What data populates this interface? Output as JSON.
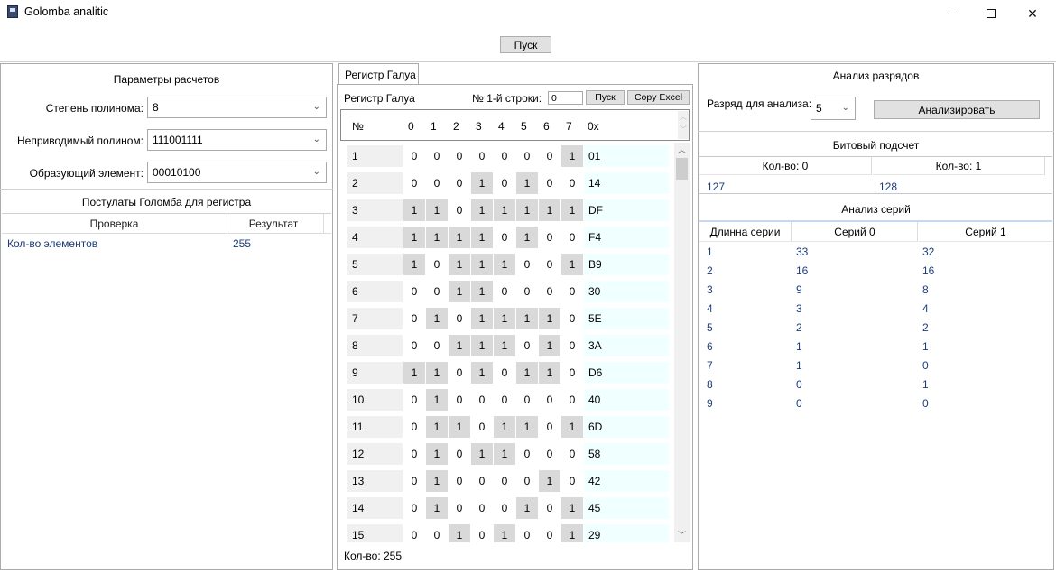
{
  "window": {
    "title": "Golomba analitic"
  },
  "toolbar": {
    "start_label": "Пуск"
  },
  "left": {
    "params_title": "Параметры расчетов",
    "degree_label": "Степень полинома:",
    "degree_value": "8",
    "irreducible_label": "Неприводимый полином:",
    "irreducible_value": "111001111",
    "generator_label": "Образующий элемент:",
    "generator_value": "00010100",
    "postulates_title": "Постулаты Голомба для регистра",
    "col_check": "Проверка",
    "col_result": "Результат",
    "rows": [
      {
        "check": "Кол-во элементов",
        "result": "255"
      }
    ]
  },
  "middle": {
    "tab_label": "Регистр Галуа",
    "register_label": "Регистр Галуа",
    "row_label": "№ 1-й строки:",
    "row_value": "0",
    "run_label": "Пуск",
    "copy_label": "Copy Excel",
    "headers": [
      "№",
      "0",
      "1",
      "2",
      "3",
      "4",
      "5",
      "6",
      "7",
      "0x"
    ],
    "rows": [
      {
        "n": "1",
        "bits": [
          0,
          0,
          0,
          0,
          0,
          0,
          0,
          1
        ],
        "hex": "01"
      },
      {
        "n": "2",
        "bits": [
          0,
          0,
          0,
          1,
          0,
          1,
          0,
          0
        ],
        "hex": "14"
      },
      {
        "n": "3",
        "bits": [
          1,
          1,
          0,
          1,
          1,
          1,
          1,
          1
        ],
        "hex": "DF"
      },
      {
        "n": "4",
        "bits": [
          1,
          1,
          1,
          1,
          0,
          1,
          0,
          0
        ],
        "hex": "F4"
      },
      {
        "n": "5",
        "bits": [
          1,
          0,
          1,
          1,
          1,
          0,
          0,
          1
        ],
        "hex": "B9"
      },
      {
        "n": "6",
        "bits": [
          0,
          0,
          1,
          1,
          0,
          0,
          0,
          0
        ],
        "hex": "30"
      },
      {
        "n": "7",
        "bits": [
          0,
          1,
          0,
          1,
          1,
          1,
          1,
          0
        ],
        "hex": "5E"
      },
      {
        "n": "8",
        "bits": [
          0,
          0,
          1,
          1,
          1,
          0,
          1,
          0
        ],
        "hex": "3A"
      },
      {
        "n": "9",
        "bits": [
          1,
          1,
          0,
          1,
          0,
          1,
          1,
          0
        ],
        "hex": "D6"
      },
      {
        "n": "10",
        "bits": [
          0,
          1,
          0,
          0,
          0,
          0,
          0,
          0
        ],
        "hex": "40"
      },
      {
        "n": "11",
        "bits": [
          0,
          1,
          1,
          0,
          1,
          1,
          0,
          1
        ],
        "hex": "6D"
      },
      {
        "n": "12",
        "bits": [
          0,
          1,
          0,
          1,
          1,
          0,
          0,
          0
        ],
        "hex": "58"
      },
      {
        "n": "13",
        "bits": [
          0,
          1,
          0,
          0,
          0,
          0,
          1,
          0
        ],
        "hex": "42"
      },
      {
        "n": "14",
        "bits": [
          0,
          1,
          0,
          0,
          0,
          1,
          0,
          1
        ],
        "hex": "45"
      },
      {
        "n": "15",
        "bits": [
          0,
          0,
          1,
          0,
          1,
          0,
          0,
          1
        ],
        "hex": "29"
      }
    ],
    "count_label": "Кол-во: 255"
  },
  "right": {
    "bits_title": "Анализ разрядов",
    "digit_label": "Разряд для анализа:",
    "digit_value": "5",
    "analyze_label": "Анализировать",
    "bitcount_title": "Битовый подсчет",
    "count0_header": "Кол-во: 0",
    "count1_header": "Кол-во: 1",
    "count0_value": "127",
    "count1_value": "128",
    "series_title": "Анализ серий",
    "series_headers": [
      "Длинна серии",
      "Серий 0",
      "Серий 1"
    ],
    "series_rows": [
      [
        "1",
        "33",
        "32"
      ],
      [
        "2",
        "16",
        "16"
      ],
      [
        "3",
        "9",
        "8"
      ],
      [
        "4",
        "3",
        "4"
      ],
      [
        "5",
        "2",
        "2"
      ],
      [
        "6",
        "1",
        "1"
      ],
      [
        "7",
        "1",
        "0"
      ],
      [
        "8",
        "0",
        "1"
      ],
      [
        "9",
        "0",
        "0"
      ]
    ]
  }
}
